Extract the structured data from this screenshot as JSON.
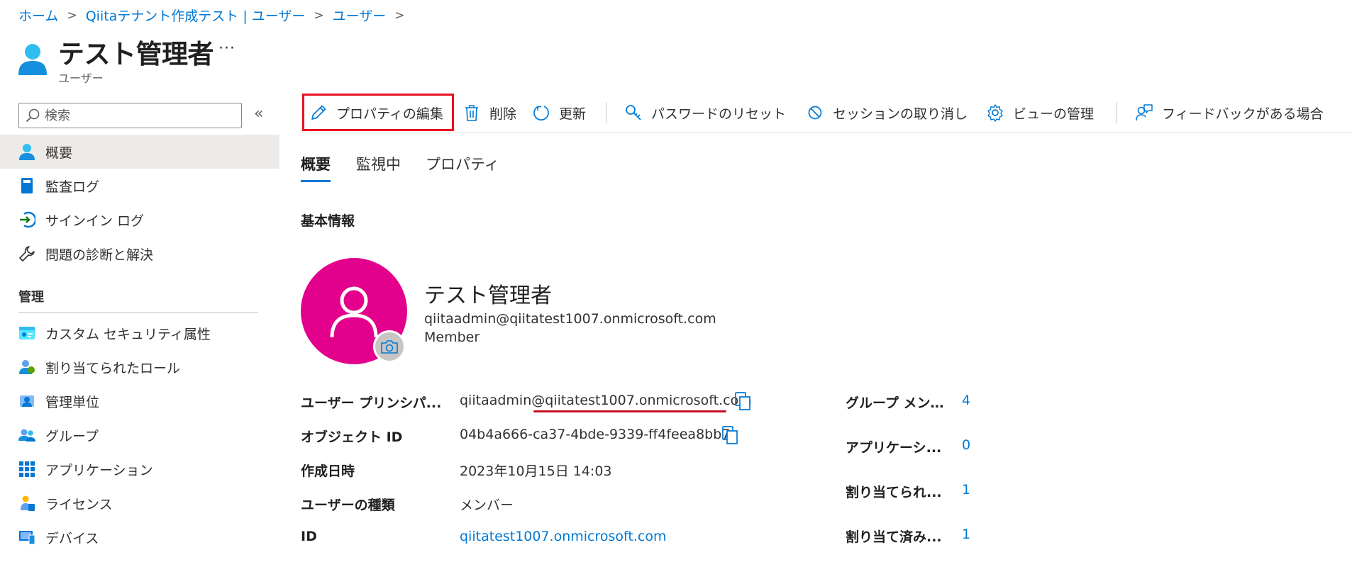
{
  "breadcrumb": {
    "items": [
      "ホーム",
      "Qiitaテナント作成テスト | ユーザー",
      "ユーザー"
    ],
    "separator": ">"
  },
  "header": {
    "title": "テスト管理者",
    "subtitle": "ユーザー",
    "more": "···",
    "icon": "user-icon"
  },
  "sidebar": {
    "search_placeholder": "検索",
    "collapse_label": "«",
    "items": [
      {
        "label": "概要",
        "icon": "user-icon",
        "active": true
      },
      {
        "label": "監査ログ",
        "icon": "book-icon"
      },
      {
        "label": "サインイン ログ",
        "icon": "signin-icon"
      },
      {
        "label": "問題の診断と解決",
        "icon": "wrench-icon"
      }
    ],
    "section_label": "管理",
    "manage_items": [
      {
        "label": "カスタム セキュリティ属性",
        "icon": "security-attribute-icon"
      },
      {
        "label": "割り当てられたロール",
        "icon": "role-icon"
      },
      {
        "label": "管理単位",
        "icon": "admin-unit-icon"
      },
      {
        "label": "グループ",
        "icon": "group-icon"
      },
      {
        "label": "アプリケーション",
        "icon": "grid-icon"
      },
      {
        "label": "ライセンス",
        "icon": "license-icon"
      },
      {
        "label": "デバイス",
        "icon": "device-icon"
      }
    ]
  },
  "toolbar": {
    "edit_label": "プロパティの編集",
    "delete_label": "削除",
    "refresh_label": "更新",
    "reset_password_label": "パスワードのリセット",
    "revoke_sessions_label": "セッションの取り消し",
    "manage_view_label": "ビューの管理",
    "feedback_label": "フィードバックがある場合"
  },
  "tabs": [
    {
      "label": "概要",
      "active": true
    },
    {
      "label": "監視中"
    },
    {
      "label": "プロパティ"
    }
  ],
  "section_title": "基本情報",
  "profile": {
    "name": "テスト管理者",
    "email": "qiitaadmin@qiitatest1007.onmicrosoft.com",
    "type": "Member",
    "avatar_color": "#e3008c"
  },
  "properties": [
    {
      "label": "ユーザー プリンシパ...",
      "value": "qiitaadmin@qiitatest1007.onmicrosoft.com",
      "copy": true
    },
    {
      "label": "オブジェクト ID",
      "value": "04b4a666-ca37-4bde-9339-ff4feea8bb7c",
      "copy": true
    },
    {
      "label": "作成日時",
      "value": "2023年10月15日 14:03"
    },
    {
      "label": "ユーザーの種類",
      "value": "メンバー"
    },
    {
      "label": "ID",
      "value": "qiitatest1007.onmicrosoft.com",
      "link": true
    }
  ],
  "stats": [
    {
      "label": "グループ メン...",
      "value": "4"
    },
    {
      "label": "アプリケーシ...",
      "value": "0"
    },
    {
      "label": "割り当てられ...",
      "value": "1"
    },
    {
      "label": "割り当て済み...",
      "value": "1"
    }
  ],
  "colors": {
    "accent": "#0078d4",
    "highlight": "#e81123",
    "avatar": "#e3008c"
  }
}
